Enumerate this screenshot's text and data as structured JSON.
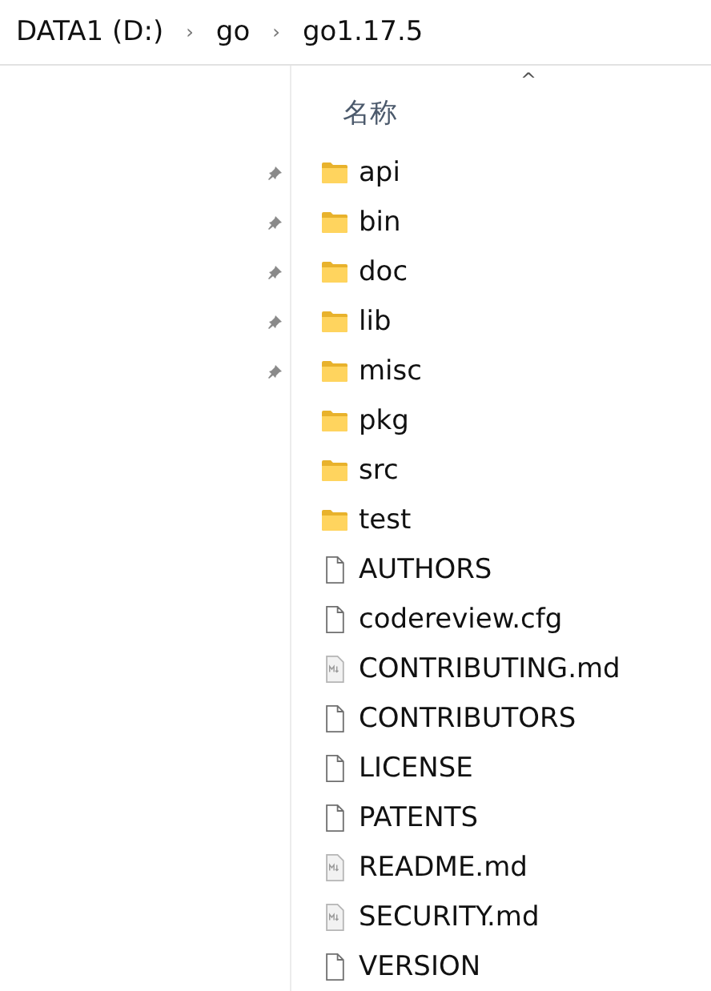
{
  "breadcrumb": [
    {
      "label": "DATA1 (D:)",
      "separator": "›"
    },
    {
      "label": "go",
      "separator": "›"
    },
    {
      "label": "go1.17.5"
    }
  ],
  "navigation_pane": {
    "items": [
      {
        "pinned": true
      },
      {
        "pinned": true
      },
      {
        "pinned": true
      },
      {
        "pinned": true
      },
      {
        "pinned": true
      }
    ]
  },
  "file_list": {
    "columns": [
      {
        "label": "名称",
        "sort_indicator": "^"
      }
    ],
    "items": [
      {
        "name": "api",
        "kind": "folder"
      },
      {
        "name": "bin",
        "kind": "folder"
      },
      {
        "name": "doc",
        "kind": "folder"
      },
      {
        "name": "lib",
        "kind": "folder"
      },
      {
        "name": "misc",
        "kind": "folder"
      },
      {
        "name": "pkg",
        "kind": "folder"
      },
      {
        "name": "src",
        "kind": "folder"
      },
      {
        "name": "test",
        "kind": "folder"
      },
      {
        "name": "AUTHORS",
        "kind": "file"
      },
      {
        "name": "codereview.cfg",
        "kind": "file"
      },
      {
        "name": "CONTRIBUTING.md",
        "kind": "markdown"
      },
      {
        "name": "CONTRIBUTORS",
        "kind": "file"
      },
      {
        "name": "LICENSE",
        "kind": "file"
      },
      {
        "name": "PATENTS",
        "kind": "file"
      },
      {
        "name": "README.md",
        "kind": "markdown"
      },
      {
        "name": "SECURITY.md",
        "kind": "markdown"
      },
      {
        "name": "VERSION",
        "kind": "file"
      }
    ]
  }
}
